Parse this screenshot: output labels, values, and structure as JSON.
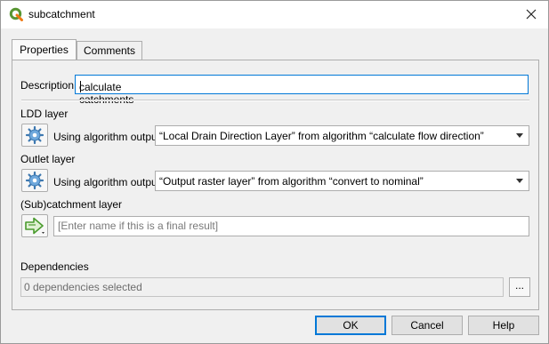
{
  "window": {
    "title": "subcatchment",
    "close_icon": "close-icon",
    "app_icon": "qgis-logo-icon"
  },
  "tabs": [
    {
      "label": "Properties",
      "active": true
    },
    {
      "label": "Comments",
      "active": false
    }
  ],
  "description": {
    "label": "Description",
    "value": "calculate catchments"
  },
  "ldd": {
    "label": "LDD layer",
    "mode_label": "Using algorithm output",
    "value": "“Local Drain Direction Layer” from algorithm “calculate flow direction”",
    "icon": "gear-icon"
  },
  "outlet": {
    "label": "Outlet layer",
    "mode_label": "Using algorithm output",
    "value": "“Output raster layer” from algorithm “convert to nominal”",
    "icon": "gear-icon"
  },
  "subcatchment": {
    "label": "(Sub)catchment layer",
    "placeholder": "[Enter name if this is a final result]",
    "value": "",
    "icon": "arrow-right-icon"
  },
  "dependencies": {
    "label": "Dependencies",
    "value": "0 dependencies selected",
    "button_label": "..."
  },
  "buttons": {
    "ok": "OK",
    "cancel": "Cancel",
    "help": "Help"
  },
  "colors": {
    "accent": "#0078d7",
    "arrow_green": "#4a9b2e"
  }
}
